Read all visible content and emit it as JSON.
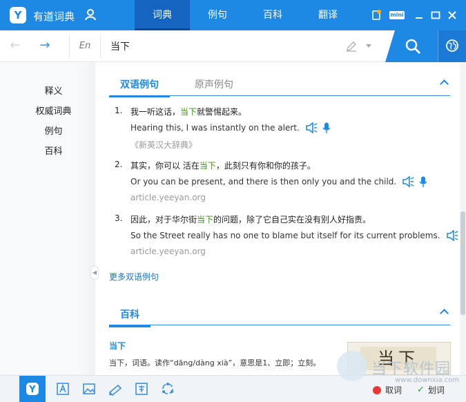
{
  "app": {
    "title": "有道词典",
    "logo_glyph": "Y"
  },
  "nav": {
    "tabs": [
      {
        "label": "词典",
        "active": true
      },
      {
        "label": "例句",
        "active": false
      },
      {
        "label": "百科",
        "active": false
      },
      {
        "label": "翻译",
        "active": false
      }
    ],
    "mini_label": "mini"
  },
  "search": {
    "lang": "En",
    "query": "当下"
  },
  "sidebar": {
    "items": [
      "释义",
      "权威词典",
      "例句",
      "百科"
    ]
  },
  "examples": {
    "tab_bilingual": "双语例句",
    "tab_original": "原声例句",
    "items": [
      {
        "num": "1.",
        "zh_before": "我一听这话，",
        "zh_hl": "当下",
        "zh_after": "就警惕起来。",
        "en": "Hearing this, I was instantly on the alert.",
        "source": "《新英汉大辞典》"
      },
      {
        "num": "2.",
        "zh_before": "其实，你可以 活在",
        "zh_hl": "当下",
        "zh_after": "，此刻只有你和你的孩子。",
        "en": "Or you can be present, and there is then only you and the child.",
        "source": "article.yeeyan.org"
      },
      {
        "num": "3.",
        "zh_before": "因此，对于华尔街",
        "zh_hl": "当下",
        "zh_after": "的问题，除了它自己实在没有别人好指责。",
        "en": "So the Street really has no one to blame but itself for its current problems.",
        "source": "article.yeeyan.org"
      }
    ],
    "more_link": "更多双语例句"
  },
  "baike": {
    "title": "百科",
    "term": "当下",
    "desc": "当下，词语。读作“dāng/dàng xià”，意思是1、立即；立刻。",
    "image_text": "当下"
  },
  "watermark": {
    "text": "当下软件园",
    "url": "www.downxia.com"
  },
  "bottom": {
    "cancel_label": "取词",
    "ok_label": "划词"
  },
  "colors": {
    "accent": "#1e88e5",
    "highlight": "#3f8f1c"
  }
}
